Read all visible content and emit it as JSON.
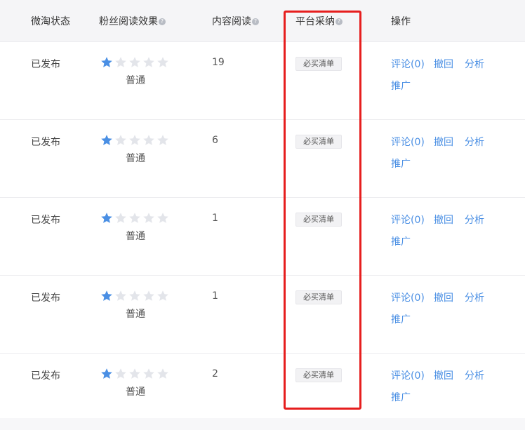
{
  "header": {
    "columns": [
      {
        "label": "微淘状态",
        "help": false
      },
      {
        "label": "粉丝阅读效果",
        "help": true
      },
      {
        "label": "内容阅读",
        "help": true
      },
      {
        "label": "平台采纳",
        "help": true
      },
      {
        "label": "操作",
        "help": false
      }
    ],
    "help_icon": "?"
  },
  "rows": [
    {
      "status": "已发布",
      "rating": 1,
      "rating_max": 5,
      "rating_label": "普通",
      "reads": "19",
      "tag": "必买清单",
      "actions": {
        "comment": "评论(0)",
        "revoke": "撤回",
        "analyze": "分析",
        "promote": "推广"
      }
    },
    {
      "status": "已发布",
      "rating": 1,
      "rating_max": 5,
      "rating_label": "普通",
      "reads": "6",
      "tag": "必买清单",
      "actions": {
        "comment": "评论(0)",
        "revoke": "撤回",
        "analyze": "分析",
        "promote": "推广"
      }
    },
    {
      "status": "已发布",
      "rating": 1,
      "rating_max": 5,
      "rating_label": "普通",
      "reads": "1",
      "tag": "必买清单",
      "actions": {
        "comment": "评论(0)",
        "revoke": "撤回",
        "analyze": "分析",
        "promote": "推广"
      }
    },
    {
      "status": "已发布",
      "rating": 1,
      "rating_max": 5,
      "rating_label": "普通",
      "reads": "1",
      "tag": "必买清单",
      "actions": {
        "comment": "评论(0)",
        "revoke": "撤回",
        "analyze": "分析",
        "promote": "推广"
      }
    },
    {
      "status": "已发布",
      "rating": 1,
      "rating_max": 5,
      "rating_label": "普通",
      "reads": "2",
      "tag": "必买清单",
      "actions": {
        "comment": "评论(0)",
        "revoke": "撤回",
        "analyze": "分析",
        "promote": "推广"
      }
    }
  ],
  "colors": {
    "star_filled": "#4a8fe4",
    "star_empty": "#e3e5ea",
    "link": "#4a8fe4",
    "highlight": "#e61e1e"
  }
}
